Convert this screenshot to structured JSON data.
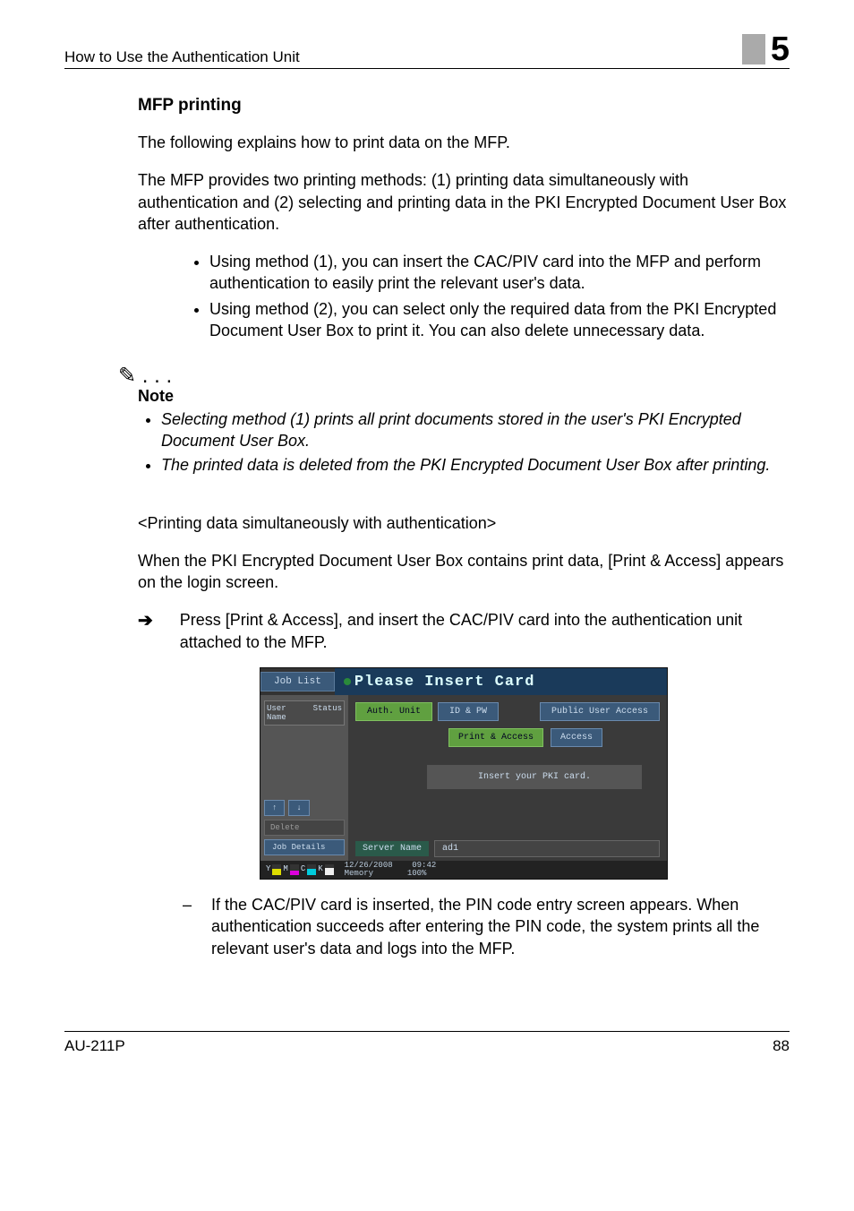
{
  "header": {
    "title": "How to Use the Authentication Unit",
    "num": "5"
  },
  "section": {
    "heading": "MFP printing",
    "p1": "The following explains how to print data on the MFP.",
    "p2": "The MFP provides two printing methods: (1) printing data simultaneously with authentication and (2) selecting and printing data in the PKI Encrypted Document User Box after authentication.",
    "bullets": [
      "Using method (1), you can insert the CAC/PIV card into the MFP and perform authentication to easily print the relevant user's data.",
      "Using method (2), you can select only the required data from the PKI Encrypted Document User Box to print it. You can also delete unnecessary data."
    ],
    "note_label": "Note",
    "note_items": [
      "Selecting method (1) prints all print documents stored in the user's PKI Encrypted Document User Box.",
      "The printed data is deleted from the PKI Encrypted Document User Box after printing."
    ],
    "subhead": "<Printing data simultaneously with authentication>",
    "p3": "When the PKI Encrypted Document User Box contains print data, [Print & Access] appears on the login screen.",
    "arrow_item": "Press [Print & Access], and insert the CAC/PIV card into the authentication unit attached to the MFP.",
    "dash_item": "If the CAC/PIV card is inserted, the PIN code entry screen appears. When authentication succeeds after entering the PIN code, the system prints all the relevant user's data and logs into the MFP."
  },
  "mfp": {
    "job_list": "Job List",
    "title": "Please Insert Card",
    "left_user": "User",
    "left_name": "Name",
    "left_status": "Status",
    "left_delete": "Delete",
    "left_jobdetails": "Job Details",
    "left_up": "↑",
    "left_down": "↓",
    "tab_auth": "Auth. Unit",
    "tab_idpw": "ID & PW",
    "tab_public": "Public User Access",
    "btn_print": "Print & Access",
    "btn_access": "Access",
    "msg": "Insert your PKI card.",
    "server_label": "Server Name",
    "server_val": "ad1",
    "foot_date": "12/26/2008",
    "foot_time": "09:42",
    "foot_mem_l": "Memory",
    "foot_mem_v": "100%",
    "tY": "Y",
    "tM": "M",
    "tC": "C",
    "tK": "K"
  },
  "footer": {
    "model": "AU-211P",
    "page": "88"
  }
}
